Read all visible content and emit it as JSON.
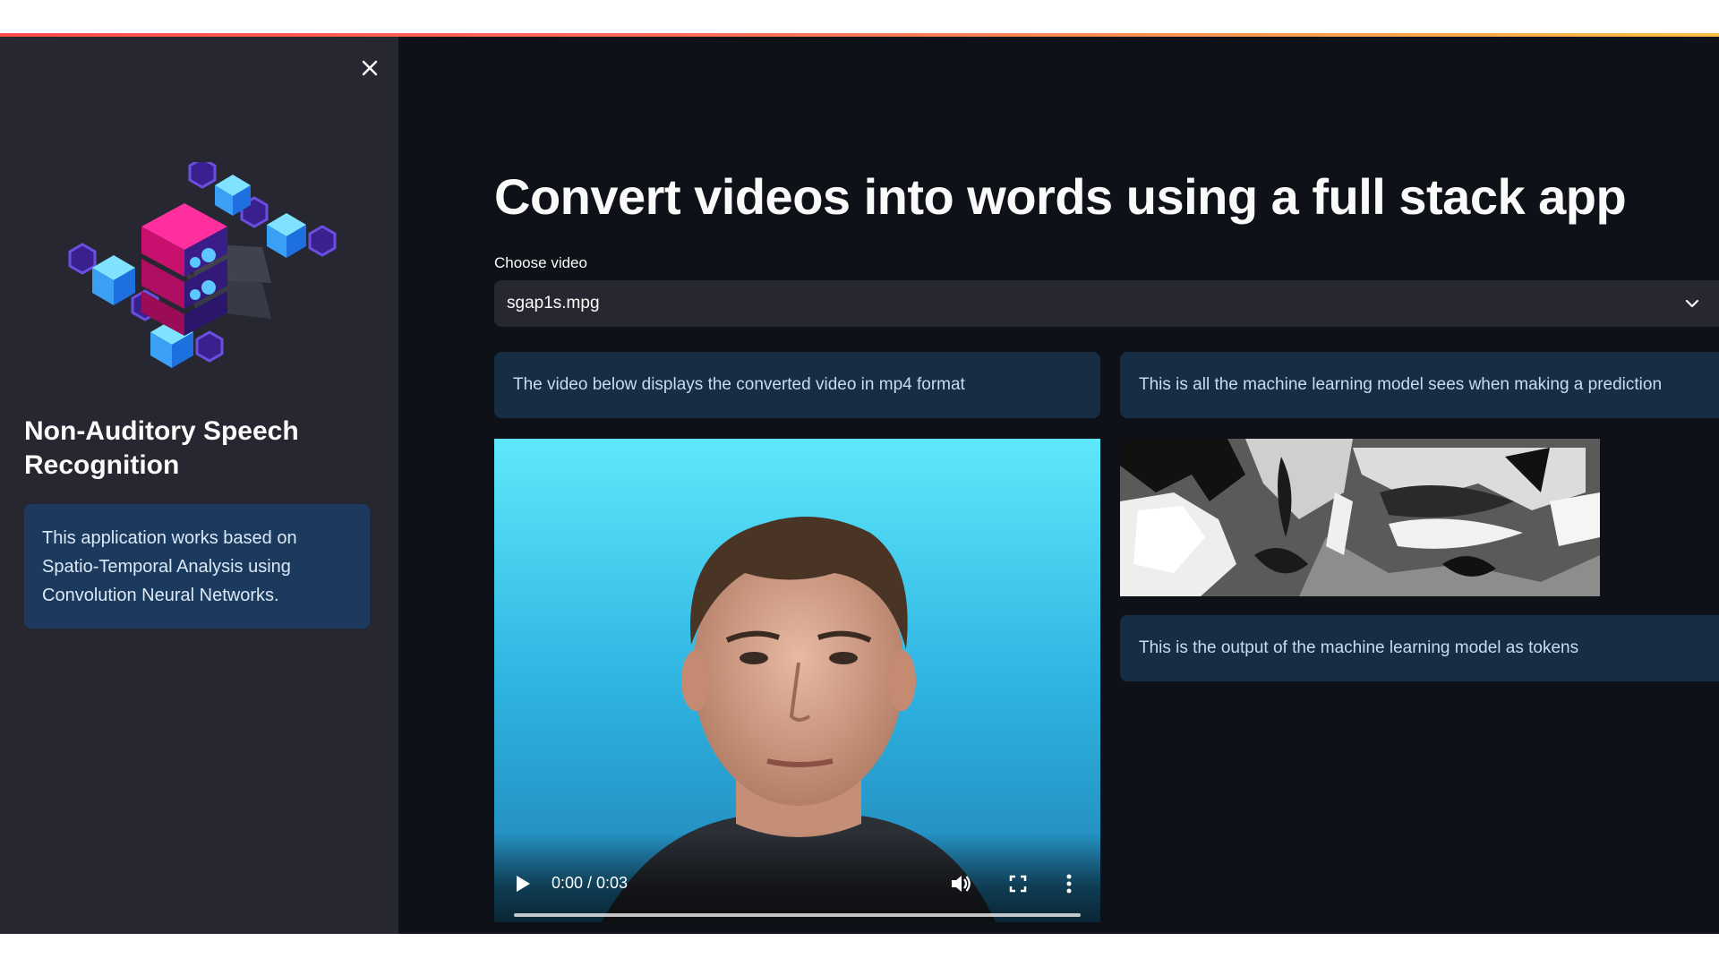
{
  "sidebar": {
    "close_icon": "close-icon",
    "logo_icon": "isometric-server-cubes-logo",
    "title": "Non-Auditory Speech Recognition",
    "info": "This application works based on Spatio-Temporal Analysis using Convolution Neural Networks."
  },
  "main": {
    "title": "Convert videos into words using a full stack app",
    "select": {
      "label": "Choose video",
      "value": "sgap1s.mpg",
      "icon": "chevron-down-icon"
    },
    "left_column": {
      "info": "The video below displays the converted video in mp4 format",
      "video": {
        "time": "0:00 / 0:03",
        "progress": 0,
        "play_icon": "play-icon",
        "volume_icon": "volume-icon",
        "fullscreen_icon": "fullscreen-icon",
        "more_icon": "more-vertical-icon"
      }
    },
    "right_column": {
      "info": "This is all the machine learning model sees when making a prediction",
      "tokens_info": "This is the output of the machine learning model as tokens"
    }
  },
  "colors": {
    "app_background": "#0e1117",
    "sidebar_background": "#262730",
    "info_box": "#172d43",
    "accent_red": "#ff4b4b",
    "accent_yellow": "#ffbd45"
  }
}
